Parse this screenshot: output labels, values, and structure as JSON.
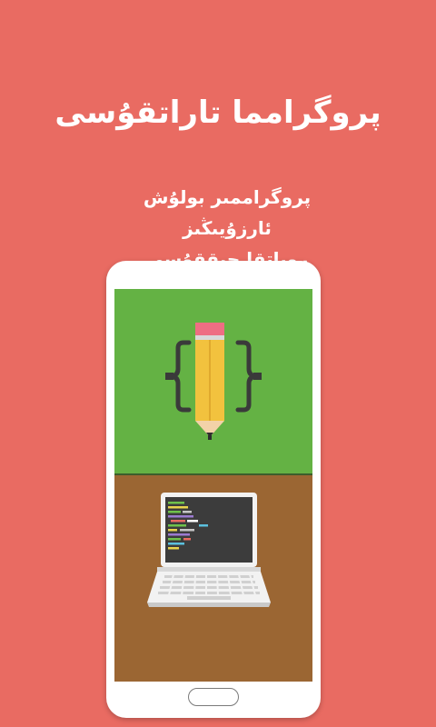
{
  "header": {
    "title": "پروگرامما تاراتقۇسى"
  },
  "intro": {
    "line1": "پروگراممىر بولۇش ئارزۇيىڭىز",
    "line2": "روياتقا چىققۇسى"
  },
  "colors": {
    "background": "#E96B62",
    "phone_body": "#FFFFFF",
    "top_panel": "#64B244",
    "bottom_panel": "#9B6633",
    "pencil_body": "#F2C23E",
    "pencil_eraser": "#EE6E83",
    "brace": "#3A3A3A",
    "laptop_screen": "#3C3C3C",
    "laptop_frame": "#F2F2F2"
  },
  "icons": {
    "top_panel": "pencil-braces-icon",
    "bottom_panel": "laptop-code-icon"
  }
}
